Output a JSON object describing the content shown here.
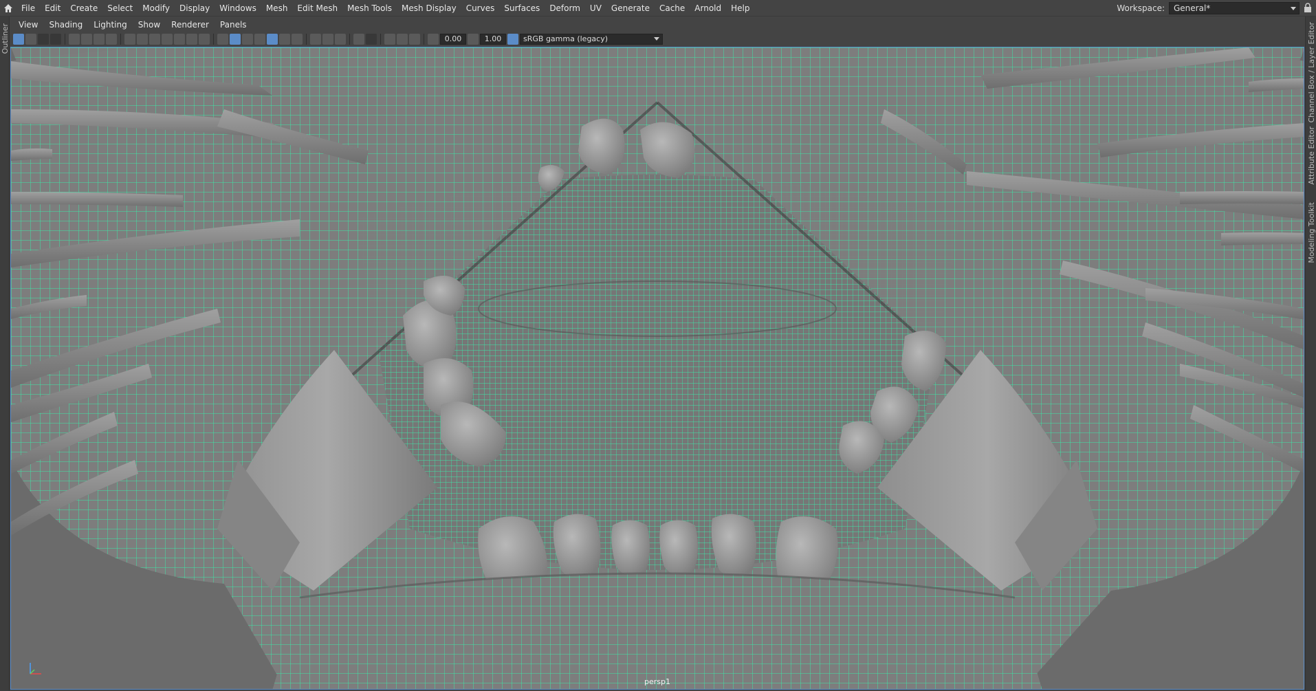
{
  "menubar": {
    "items": [
      "File",
      "Edit",
      "Create",
      "Select",
      "Modify",
      "Display",
      "Windows",
      "Mesh",
      "Edit Mesh",
      "Mesh Tools",
      "Mesh Display",
      "Curves",
      "Surfaces",
      "Deform",
      "UV",
      "Generate",
      "Cache",
      "Arnold",
      "Help"
    ],
    "workspace_label": "Workspace:",
    "workspace_value": "General*"
  },
  "left_strip": {
    "label": "Outliner"
  },
  "right_strip": {
    "tabs": [
      "Channel Box / Layer Editor",
      "Attribute Editor",
      "Modeling Toolkit"
    ]
  },
  "panel_menu": {
    "items": [
      "View",
      "Shading",
      "Lighting",
      "Show",
      "Renderer",
      "Panels"
    ]
  },
  "toolbar": {
    "exposure": "0.00",
    "gamma": "1.00",
    "color_space": "sRGB gamma (legacy)"
  },
  "viewport": {
    "camera": "persp1",
    "wire_color": "#3de6a8",
    "mesh_color": "#8a8a8a"
  }
}
